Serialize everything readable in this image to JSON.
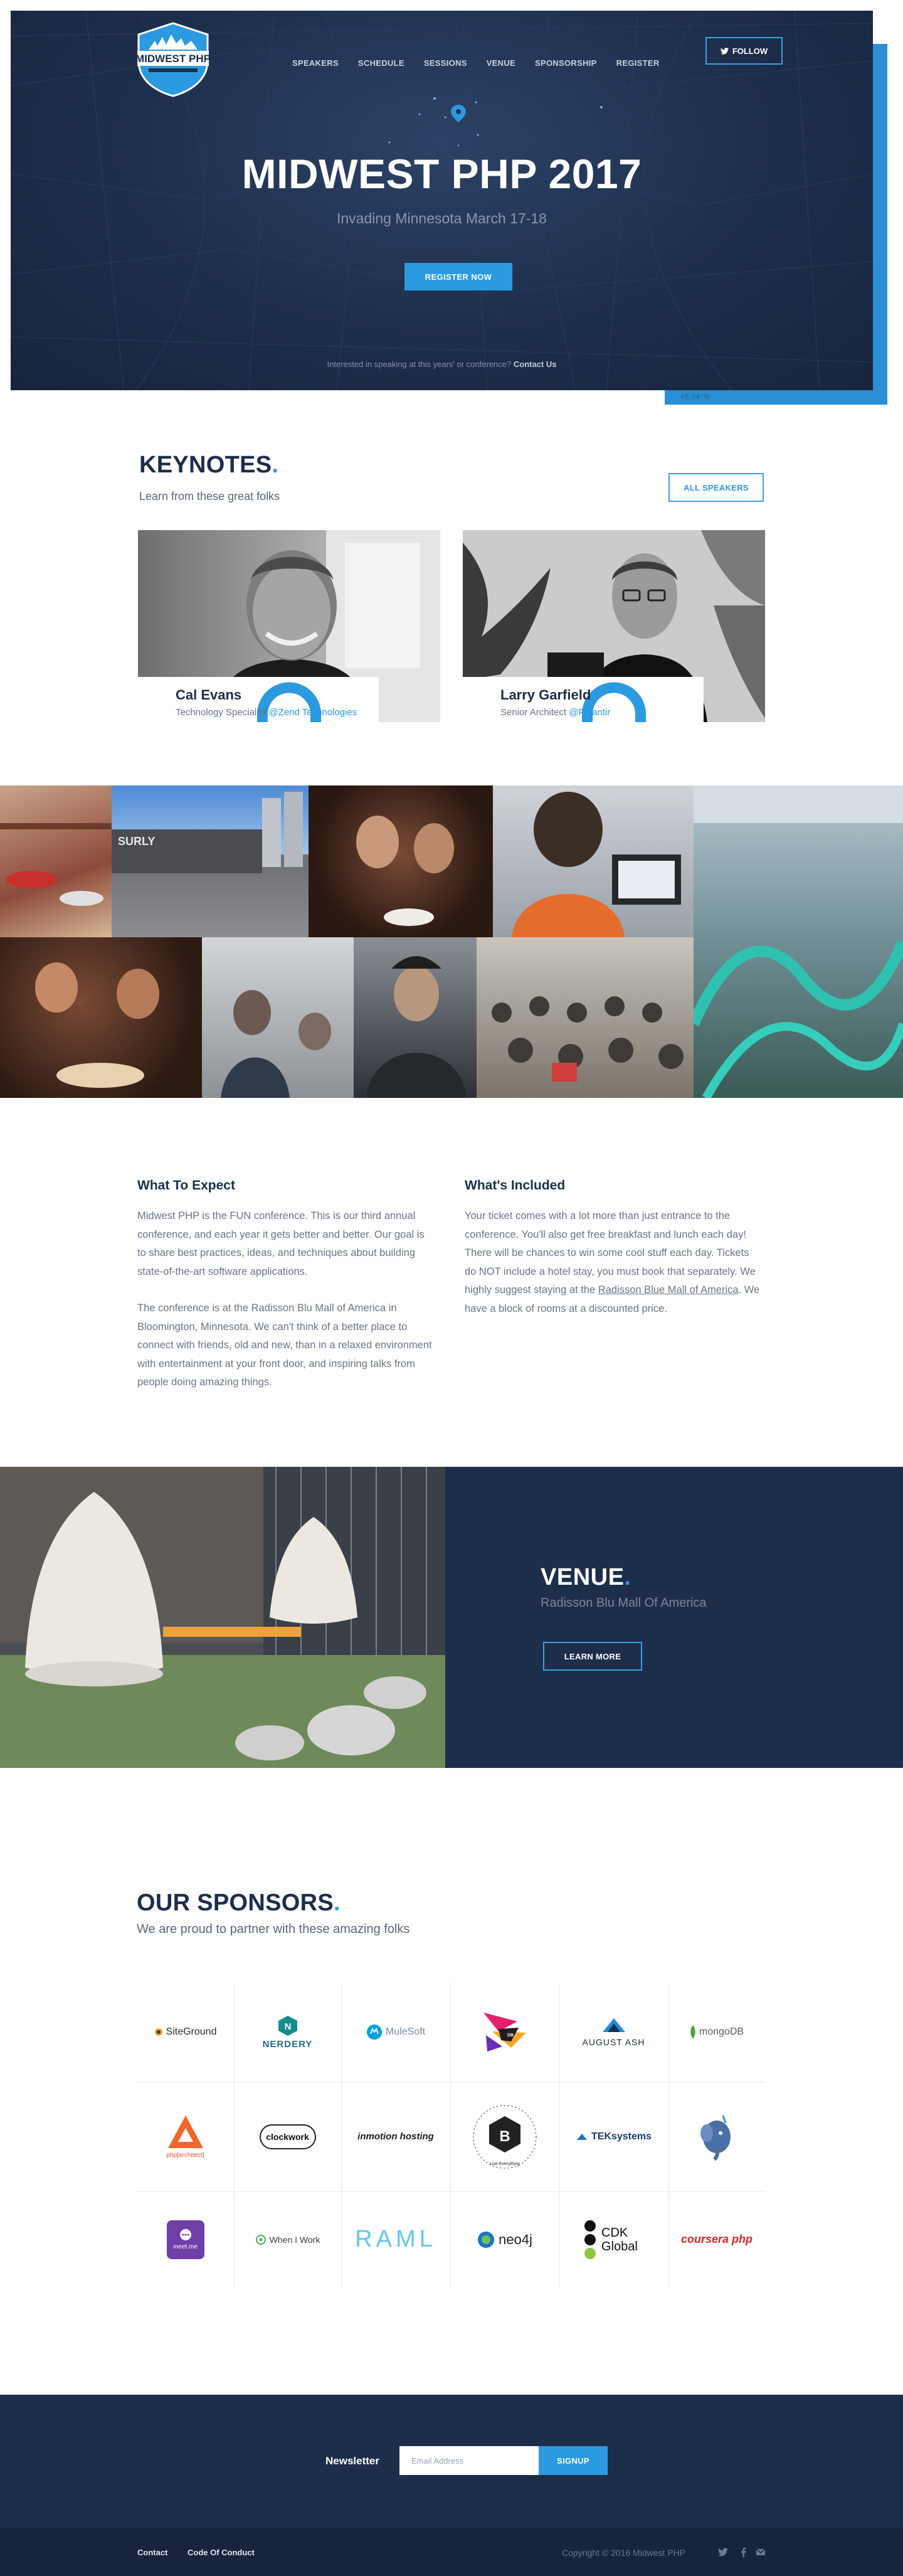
{
  "header": {
    "logo_text": "MIDWEST PHP",
    "nav": [
      "SPEAKERS",
      "SCHEDULE",
      "SESSIONS",
      "VENUE",
      "SPONSORSHIP",
      "REGISTER"
    ],
    "follow_label": "FOLLOW",
    "accent_label": "45.06°N"
  },
  "hero": {
    "title": "MIDWEST PHP 2017",
    "subtitle": "Invading Minnesota March 17-18",
    "register_label": "REGISTER NOW",
    "note": "Interested in speaking at this years' or conference?",
    "note_link": "Contact Us"
  },
  "keynotes": {
    "title": "KEYNOTES",
    "subtitle": "Learn from these great folks",
    "all_label": "ALL SPEAKERS",
    "speakers": [
      {
        "name": "Cal Evans",
        "role": "Technology Specialist",
        "company": "@Zend Technologies"
      },
      {
        "name": "Larry Garfield",
        "role": "Senior Architect",
        "company": "@Palantir"
      }
    ]
  },
  "about": {
    "expect_title": "What To Expect",
    "expect_p1": "Midwest PHP is the FUN conference. This is our third annual conference, and each year it gets better and better. Our goal is to share best practices, ideas, and techniques about building state-of-the-art software applications.",
    "expect_p2": "The conference is at the Radisson Blu Mall of America in Bloomington, Minnesota. We can't think of a better place to connect with friends, old and new, than in a relaxed environment with entertainment at your front door, and inspiring talks from people doing amazing things.",
    "included_title": "What's Included",
    "included_p1": "Your ticket comes with a lot more than just entrance to the conference. You'll also get free breakfast and lunch each day! There will be chances to win some cool stuff each day. Tickets do NOT include a hotel stay, you must book that separately. We highly suggest staying at the",
    "included_link": "Radisson Blue Mall of America",
    "included_p1_end": ". We have a block of rooms at a discounted price."
  },
  "venue": {
    "title": "VENUE",
    "subtitle": "Radisson Blu Mall Of America",
    "button_label": "LEARN MORE"
  },
  "sponsors": {
    "title": "OUR SPONSORS",
    "subtitle": "We are proud to partner with these amazing folks",
    "logos": [
      "SiteGround",
      "NERDERY",
      "MuleSoft",
      "DB",
      "AUGUST ASH",
      "mongoDB",
      "php[architect]",
      "clockwork",
      "inmotion hosting",
      "Live Everything",
      "TEKsystems",
      "",
      "meet.me",
      "When I Work",
      "RAML",
      "neo4j",
      "CDK Global",
      "coursera php"
    ]
  },
  "newsletter": {
    "label": "Newsletter",
    "placeholder": "Email Address",
    "button_label": "SIGNUP"
  },
  "footer": {
    "links": [
      "Contact",
      "Code Of Conduct"
    ],
    "copyright": "Copyright © 2016 Midwest PHP"
  },
  "colors": {
    "navy": "#1d2e4b",
    "accent": "#2b9ae0",
    "footer": "#17243c"
  }
}
